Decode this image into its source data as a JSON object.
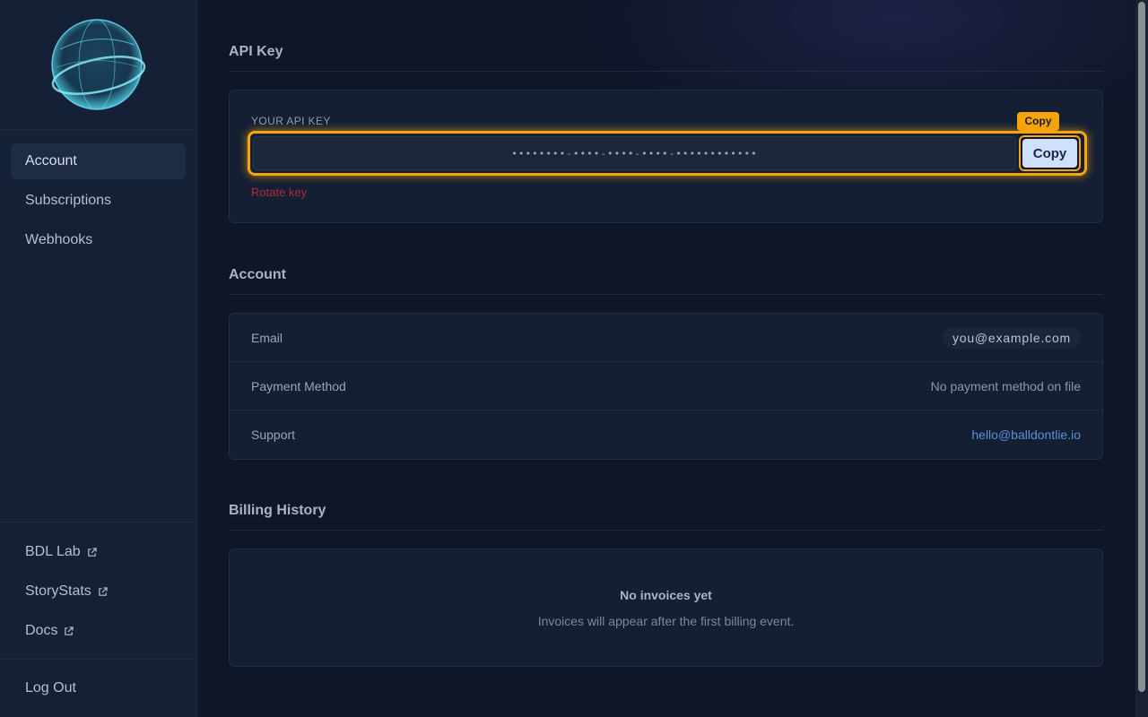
{
  "sidebar": {
    "nav": [
      {
        "label": "Account",
        "active": true
      },
      {
        "label": "Subscriptions",
        "active": false
      },
      {
        "label": "Webhooks",
        "active": false
      }
    ],
    "external_links": [
      {
        "label": "BDL Lab",
        "icon": "external-link-icon"
      },
      {
        "label": "StoryStats",
        "icon": "external-link-icon"
      },
      {
        "label": "Docs",
        "icon": "external-link-icon"
      }
    ],
    "logout_label": "Log Out"
  },
  "api_key": {
    "section_title": "API Key",
    "field_label": "YOUR API KEY",
    "masked_value": "••••••••-••••-••••-••••-••••••••••••",
    "copy_button_label": "Copy",
    "copy_tooltip": "Copy",
    "rotate_label": "Rotate key"
  },
  "account": {
    "section_title": "Account",
    "rows": [
      {
        "label": "Email",
        "value": "you@example.com"
      },
      {
        "label": "Payment Method",
        "value": "No payment method on file"
      },
      {
        "label": "Support",
        "value": "hello@balldontlie.io"
      }
    ]
  },
  "billing": {
    "section_title": "Billing History",
    "empty_title": "No invoices yet",
    "empty_subtitle": "Invoices will appear after the first billing event."
  },
  "colors": {
    "accent": "#f5a50b",
    "background": "#0e1628",
    "danger": "#b3283a",
    "link": "#5b8fd8"
  }
}
